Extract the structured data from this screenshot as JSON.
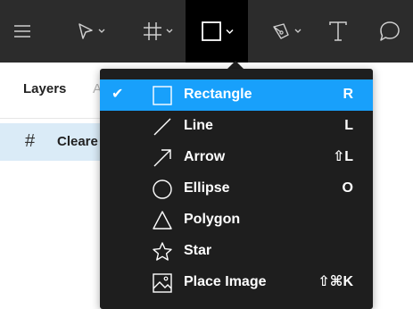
{
  "toolbar": {
    "tools": [
      {
        "icon": "hamburger-menu-icon"
      },
      {
        "icon": "move-tool-icon"
      },
      {
        "icon": "frame-tool-icon"
      },
      {
        "icon": "rectangle-tool-icon",
        "active": true
      },
      {
        "icon": "pen-tool-icon"
      },
      {
        "icon": "text-tool-icon"
      },
      {
        "icon": "comment-tool-icon"
      }
    ],
    "accent": "#18a0fb"
  },
  "panel": {
    "tab_layers": "Layers",
    "tab_assets": "A",
    "layer_name": "Cleare"
  },
  "menu": {
    "items": [
      {
        "label": "Rectangle",
        "shortcut": "R",
        "icon": "rectangle-icon",
        "selected": true,
        "check": "✔"
      },
      {
        "label": "Line",
        "shortcut": "L",
        "icon": "line-icon"
      },
      {
        "label": "Arrow",
        "shortcut": "⇧L",
        "icon": "arrow-icon"
      },
      {
        "label": "Ellipse",
        "shortcut": "O",
        "icon": "ellipse-icon"
      },
      {
        "label": "Polygon",
        "shortcut": "",
        "icon": "polygon-icon"
      },
      {
        "label": "Star",
        "shortcut": "",
        "icon": "star-icon"
      },
      {
        "label": "Place Image",
        "shortcut": "⇧⌘K",
        "icon": "image-icon"
      }
    ]
  }
}
